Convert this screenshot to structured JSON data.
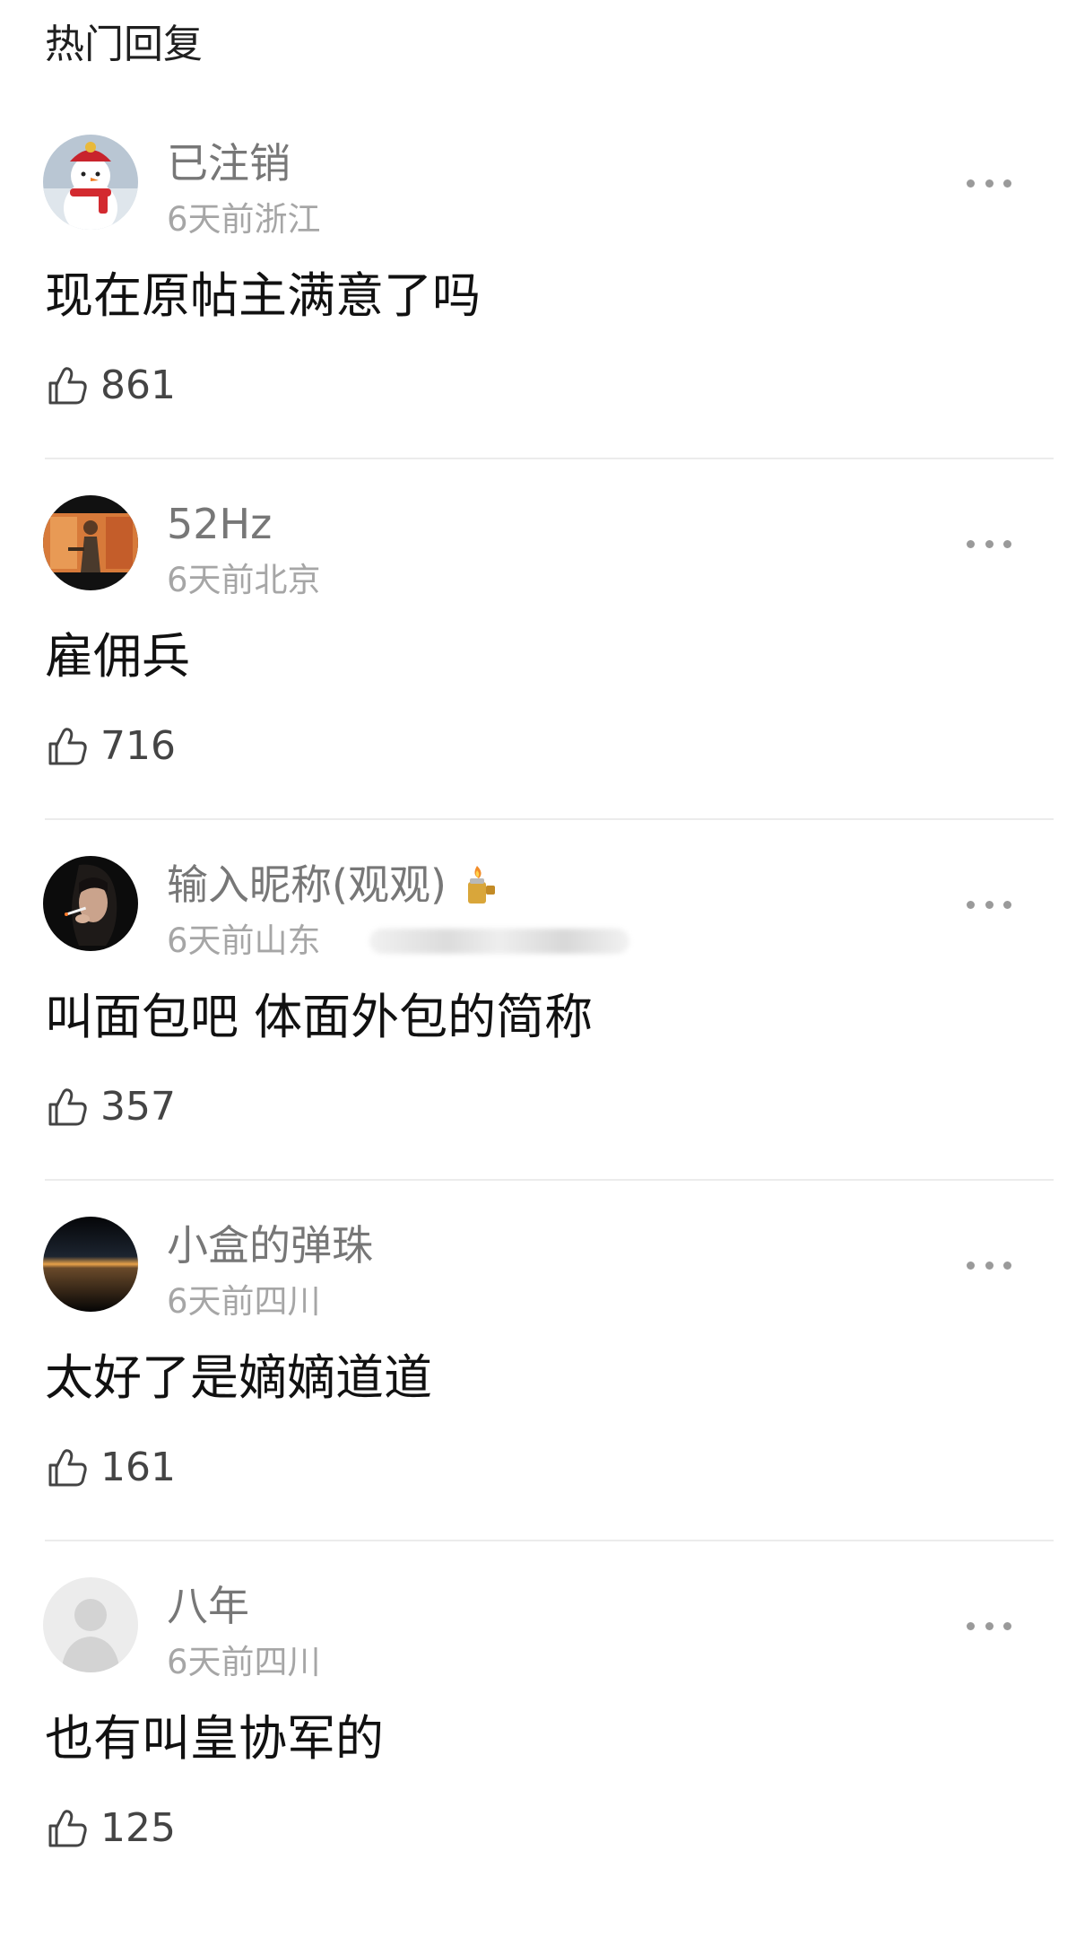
{
  "section_title": "热门回复",
  "comments": [
    {
      "username": "已注销",
      "time": "6天前",
      "location": "浙江",
      "text": "现在原帖主满意了吗",
      "likes": "861",
      "avatar": "snowman-avatar"
    },
    {
      "username": "52Hz",
      "time": "6天前",
      "location": "北京",
      "text": "雇佣兵",
      "likes": "716",
      "avatar": "movie-still-avatar"
    },
    {
      "username": "输入昵称(观观)",
      "time": "6天前",
      "location": "山东",
      "text": "叫面包吧 体面外包的简称",
      "likes": "357",
      "avatar": "smoking-woman-avatar",
      "badge": "lighter-icon"
    },
    {
      "username": "小盒的弹珠",
      "time": "6天前",
      "location": "四川",
      "text": "太好了是嫡嫡道道",
      "likes": "161",
      "avatar": "horizon-avatar"
    },
    {
      "username": "八年",
      "time": "6天前",
      "location": "四川",
      "text": "也有叫皇协军的",
      "likes": "125",
      "avatar": "default-user-avatar"
    }
  ],
  "colors": {
    "username": "#777777",
    "meta": "#a6a6a6",
    "text": "#111111",
    "divider": "#ececec"
  }
}
